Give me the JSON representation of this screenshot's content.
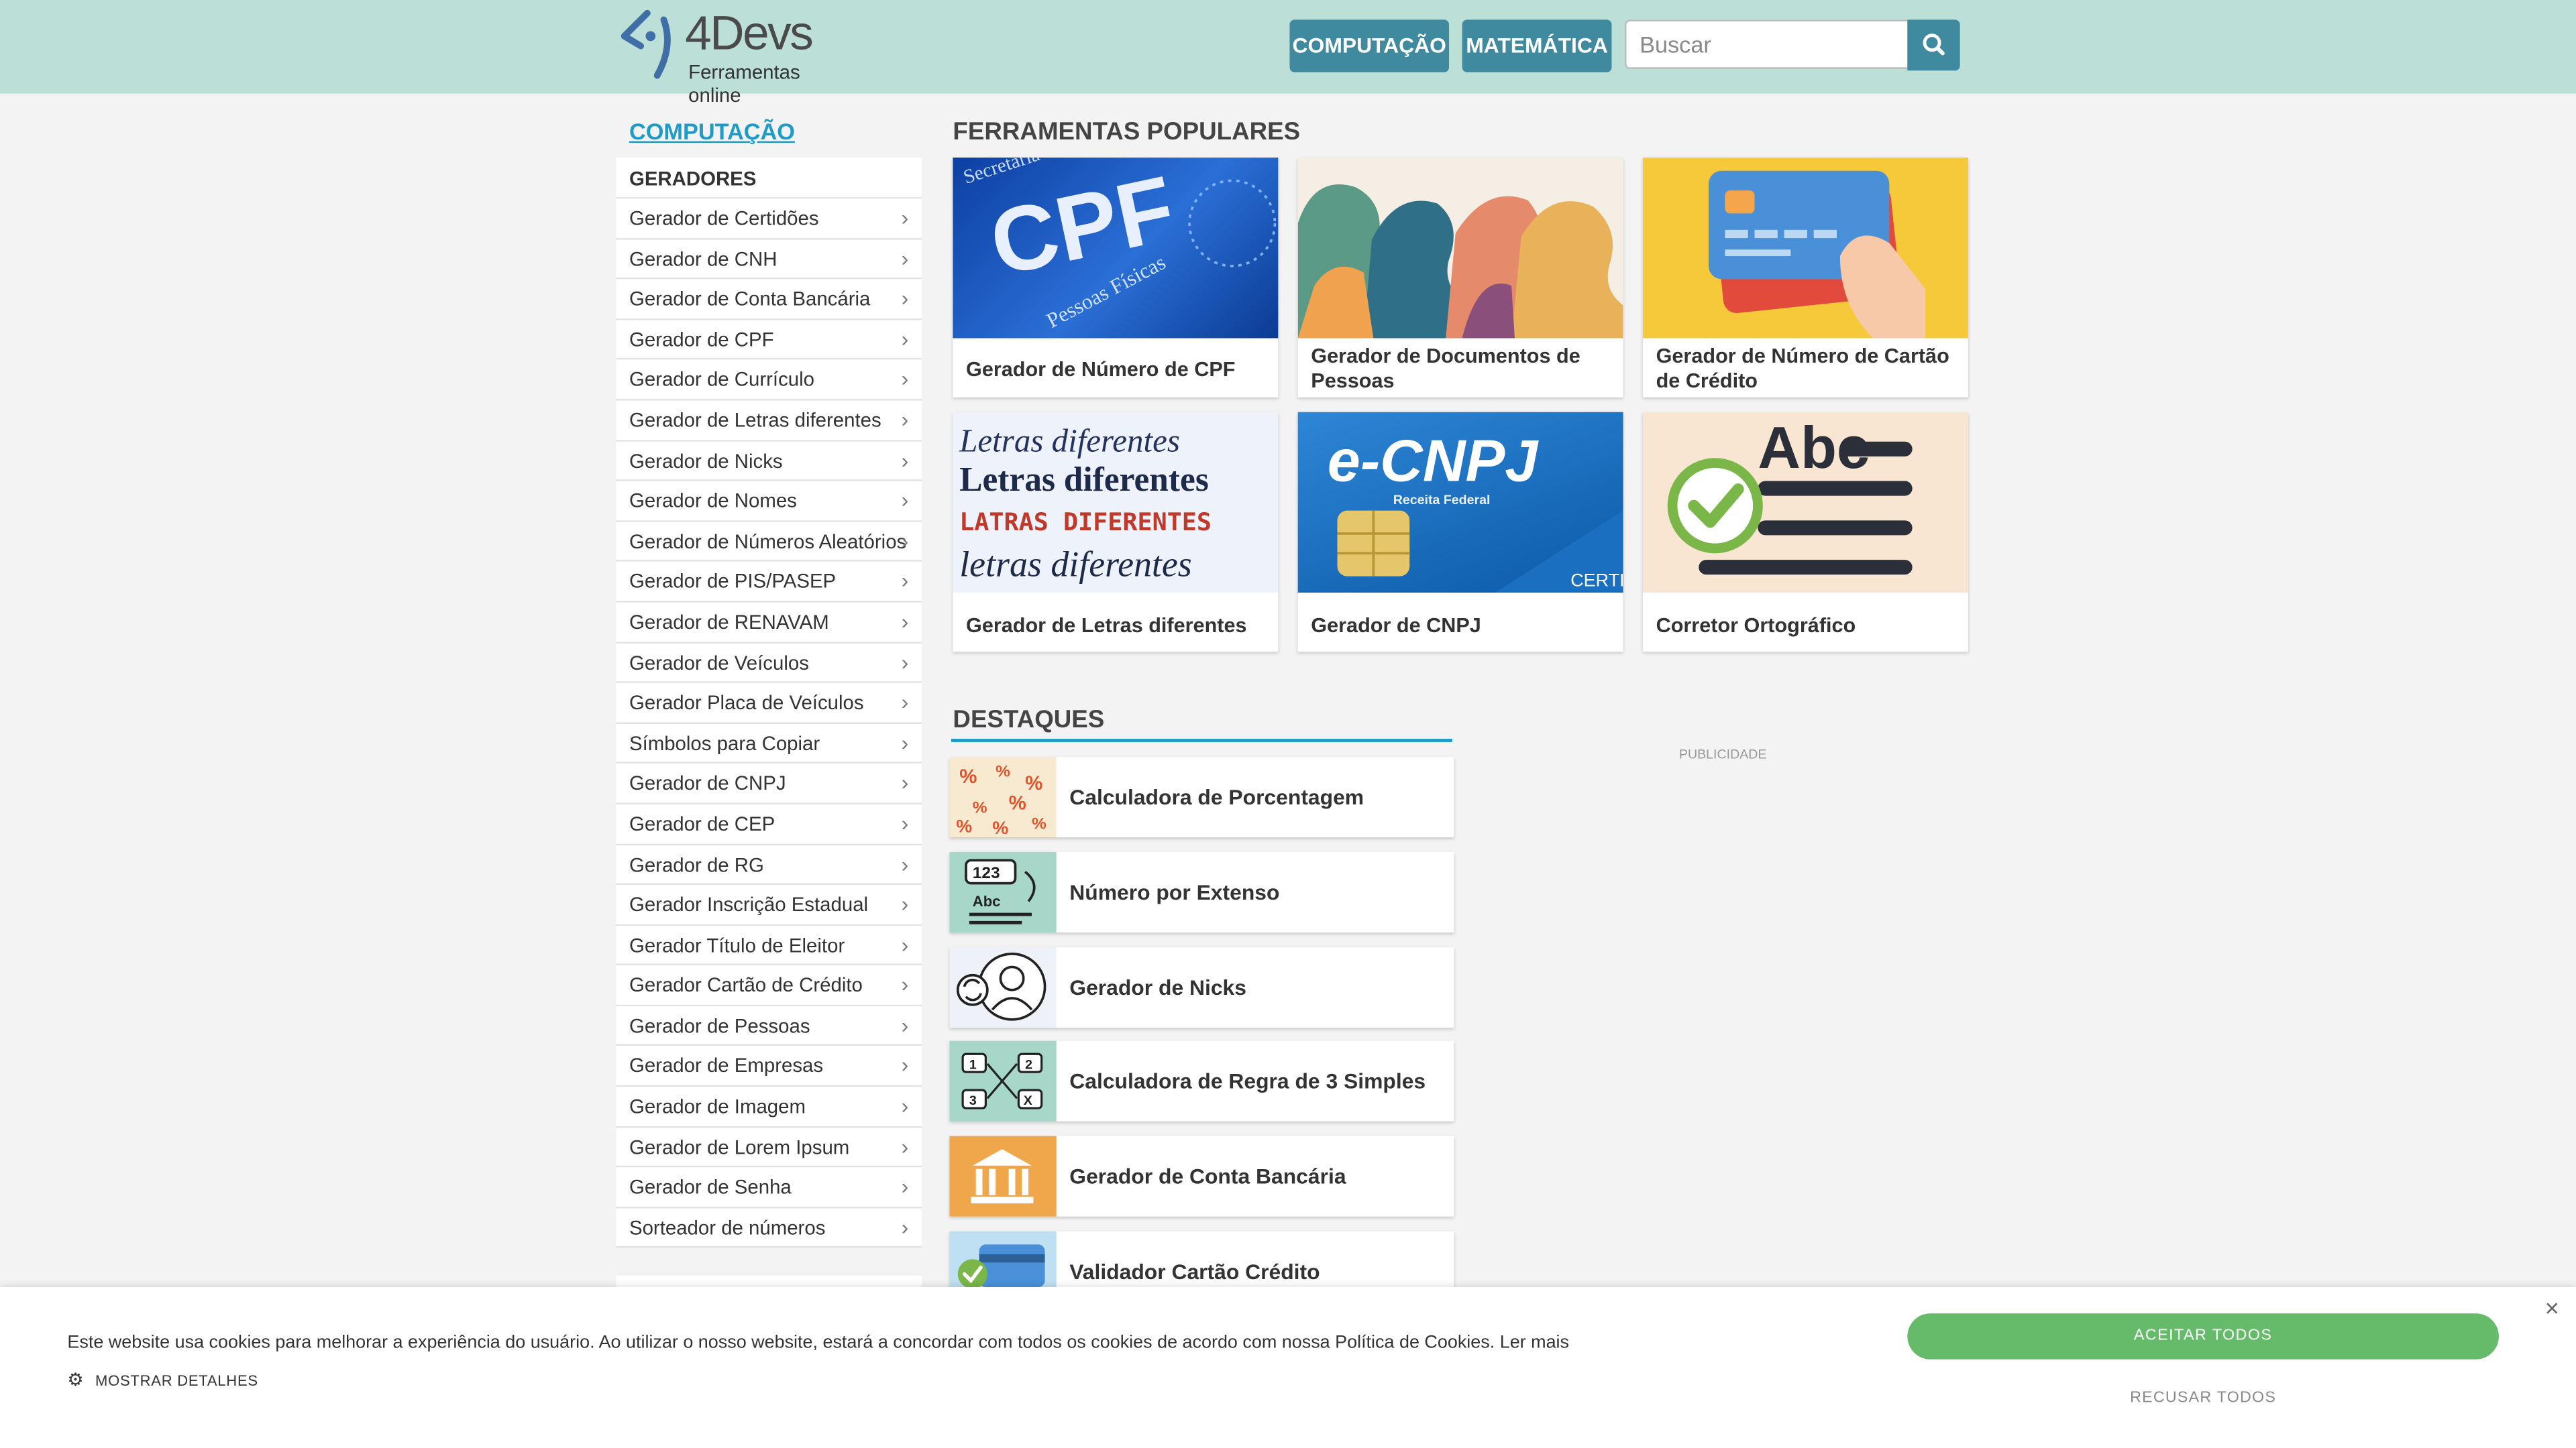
{
  "brand": {
    "name": "4Devs",
    "tagline": "Ferramentas online"
  },
  "nav": {
    "computacao": "COMPUTAÇÃO",
    "matematica": "MATEMÁTICA",
    "search_placeholder": "Buscar"
  },
  "sidebar": {
    "title": "COMPUTAÇÃO",
    "heading": "GERADORES",
    "items": [
      "Gerador de Certidões",
      "Gerador de CNH",
      "Gerador de Conta Bancária",
      "Gerador de CPF",
      "Gerador de Currículo",
      "Gerador de Letras diferentes",
      "Gerador de Nicks",
      "Gerador de Nomes",
      "Gerador de Números Aleatórios",
      "Gerador de PIS/PASEP",
      "Gerador de RENAVAM",
      "Gerador de Veículos",
      "Gerador Placa de Veículos",
      "Símbolos para Copiar",
      "Gerador de CNPJ",
      "Gerador de CEP",
      "Gerador de RG",
      "Gerador Inscrição Estadual",
      "Gerador Título de Eleitor",
      "Gerador Cartão de Crédito",
      "Gerador de Pessoas",
      "Gerador de Empresas",
      "Gerador de Imagem",
      "Gerador de Lorem Ipsum",
      "Gerador de Senha",
      "Sorteador de números"
    ]
  },
  "popular": {
    "title": "FERRAMENTAS POPULARES",
    "cards": [
      "Gerador de Número de CPF",
      "Gerador de Documentos de Pessoas",
      "Gerador de Número de Cartão de Crédito",
      "Gerador de Letras diferentes",
      "Gerador de CNPJ",
      "Corretor Ortográfico"
    ],
    "images": {
      "cpf_big": "CPF",
      "cpf_sub": "Pessoas Físicas",
      "cpf_top": "Secretaria da Receita",
      "letras": [
        "Letras diferentes",
        "Letras diferentes",
        "LATRAS DIFERENTES",
        "letras diferentes"
      ],
      "ecnpj": "e-CNPJ",
      "ecnpj_sub": "Receita Federal",
      "ecnpj_cert": "CERTIF",
      "abc": "Abc"
    }
  },
  "highlights": {
    "title": "DESTAQUES",
    "items": [
      "Calculadora de Porcentagem",
      "Número por Extenso",
      "Gerador de Nicks",
      "Calculadora de Regra de 3 Simples",
      "Gerador de Conta Bancária",
      "Validador Cartão Crédito"
    ],
    "thumb_text": {
      "num": "123",
      "abc": "Abc",
      "r1": "1",
      "r2": "2",
      "r3": "3",
      "rx": "X"
    }
  },
  "ad": {
    "label": "PUBLICIDADE"
  },
  "cookie": {
    "message": "Este website usa cookies para melhorar a experiência do usuário. Ao utilizar o nosso website, estará a concordar com todos os cookies de acordo com nossa Política de Cookies. Ler mais",
    "details": "MOSTRAR DETALHES",
    "accept": "ACEITAR TODOS",
    "refuse": "RECUSAR TODOS",
    "close": "×"
  }
}
